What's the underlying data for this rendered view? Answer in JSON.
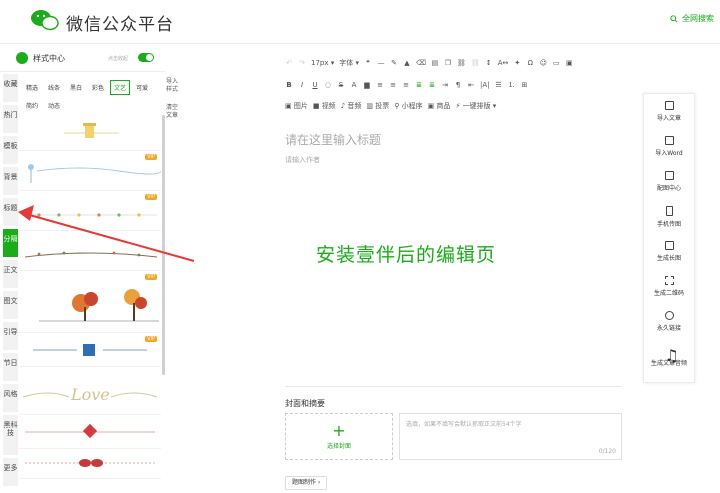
{
  "header": {
    "brand": "微信公众平台",
    "search_label": "全网搜索",
    "logo_icon": "wechat-logo-icon",
    "accent_color": "#1aad19"
  },
  "style_panel": {
    "title": "样式中心",
    "collapse_label": "点击收起",
    "toggle_on": true,
    "categories": [
      "收藏",
      "热门",
      "模板",
      "背景",
      "标题",
      "分隔",
      "正文",
      "图文",
      "引导",
      "节日",
      "风格",
      "黑科技",
      "更多"
    ],
    "active_category": "分隔",
    "filters": [
      "精选",
      "线条",
      "黑白",
      "彩色",
      "文艺",
      "可爱",
      "简约",
      "动态"
    ],
    "active_filter": "文艺",
    "vip_badge": "VIP",
    "style_items": [
      "cup-divider",
      "fish-divider",
      "flower-dots-divider",
      "leaf-branch-divider",
      "autumn-tree-divider",
      "blue-line-divider",
      "love-script-divider",
      "red-knot-divider",
      "red-bow-divider"
    ],
    "love_text": "Love",
    "side_actions": [
      "导入样式",
      "清空文章"
    ]
  },
  "toolbar": {
    "font_size": "17px",
    "font_label": "字体",
    "media": [
      "图片",
      "视频",
      "音频",
      "投票",
      "小程序",
      "商品",
      "一键排版"
    ]
  },
  "editor": {
    "title_placeholder": "请在这里输入标题",
    "author_placeholder": "请输入作者",
    "annotation": "安装壹伴后的编辑页",
    "cover_section_title": "封面和摘要",
    "cover_button_label": "选择封面",
    "summary_placeholder": "选填，如果不填写会默认抓取正文前54个字",
    "summary_count": "0/120",
    "picture_button": "题图制作"
  },
  "right_panel": {
    "items": [
      {
        "label": "导入文章",
        "icon": "import-icon"
      },
      {
        "label": "导入Word",
        "icon": "word-icon"
      },
      {
        "label": "配图中心",
        "icon": "image-icon"
      },
      {
        "label": "手机传图",
        "icon": "phone-icon"
      },
      {
        "label": "生成长图",
        "icon": "long-image-icon"
      },
      {
        "label": "生成二维码",
        "icon": "qrcode-icon"
      },
      {
        "label": "永久链接",
        "icon": "link-icon"
      },
      {
        "label": "生成文章音频",
        "icon": "audio-icon"
      }
    ]
  }
}
